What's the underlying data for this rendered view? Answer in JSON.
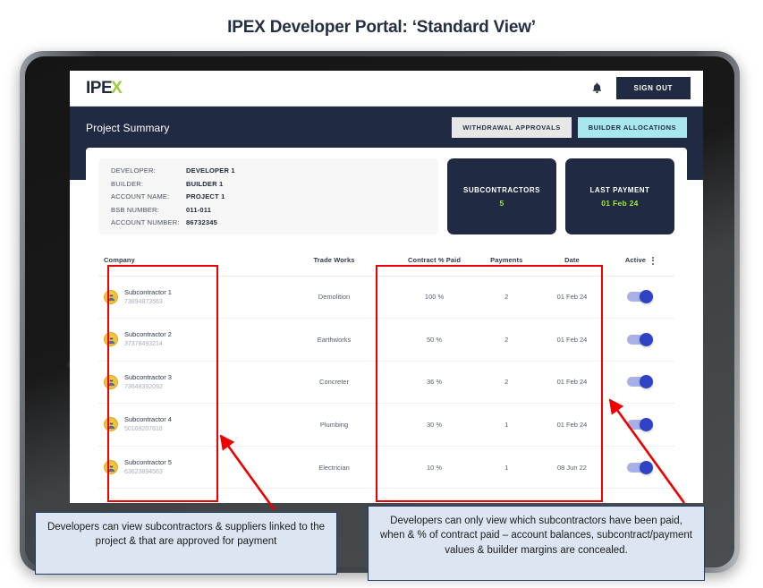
{
  "slide": {
    "title": "IPEX Developer Portal: ‘Standard View’"
  },
  "app": {
    "logo_text": "IPE",
    "logo_accent": "X",
    "bell_icon": "bell-icon",
    "sign_out_label": "SIGN OUT",
    "banner": {
      "title": "Project Summary",
      "withdrawal_approvals_label": "WITHDRAWAL APPROVALS",
      "builder_allocations_label": "BUILDER ALLOCATIONS"
    },
    "details": [
      {
        "key": "DEVELOPER:",
        "value": "DEVELOPER 1"
      },
      {
        "key": "BUILDER:",
        "value": "BUILDER 1"
      },
      {
        "key": "ACCOUNT NAME:",
        "value": "PROJECT 1"
      },
      {
        "key": "BSB NUMBER:",
        "value": "011-011"
      },
      {
        "key": "ACCOUNT NUMBER:",
        "value": "86732345"
      }
    ],
    "stats": [
      {
        "label": "SUBCONTRACTORS",
        "value": "5"
      },
      {
        "label": "LAST PAYMENT",
        "value": "01 Feb 24"
      }
    ],
    "table": {
      "columns": [
        "Company",
        "Trade Works",
        "Contract % Paid",
        "Payments",
        "Date",
        "Active"
      ],
      "kebab_icon": "more-vertical-icon",
      "rows": [
        {
          "company": "Subcontractor 1",
          "account": "73894873563",
          "trade": "Demolition",
          "percent": "100 %",
          "payments": "2",
          "date": "01 Feb 24",
          "active": true
        },
        {
          "company": "Subcontractor 2",
          "account": "37378493214",
          "trade": "Earthworks",
          "percent": "50 %",
          "payments": "2",
          "date": "01 Feb 24",
          "active": true
        },
        {
          "company": "Subcontractor 3",
          "account": "73648392092",
          "trade": "Concreter",
          "percent": "36 %",
          "payments": "2",
          "date": "01 Feb 24",
          "active": true
        },
        {
          "company": "Subcontractor 4",
          "account": "50169207818",
          "trade": "Plumbing",
          "percent": "30 %",
          "payments": "1",
          "date": "01 Feb 24",
          "active": true
        },
        {
          "company": "Subcontractor 5",
          "account": "63623894563",
          "trade": "Electrician",
          "percent": "10 %",
          "payments": "1",
          "date": "08 Jun 22",
          "active": true
        }
      ]
    }
  },
  "annotations": {
    "left_callout": "Developers can view subcontractors & suppliers linked to the project & that are approved for payment",
    "right_callout": "Developers can only view which subcontractors have been paid, when & % of contract paid – account balances, subcontract/payment values & builder margins are concealed."
  },
  "colors": {
    "navy": "#202a42",
    "accent_green": "#a3e635",
    "logo_green": "#9ccc3c",
    "cyan_pill": "#a8e7ee",
    "annotation_red": "#ee0000",
    "callout_fill": "#dce6f2",
    "callout_border": "#1f3864",
    "toggle_on": "#2f41c4"
  }
}
